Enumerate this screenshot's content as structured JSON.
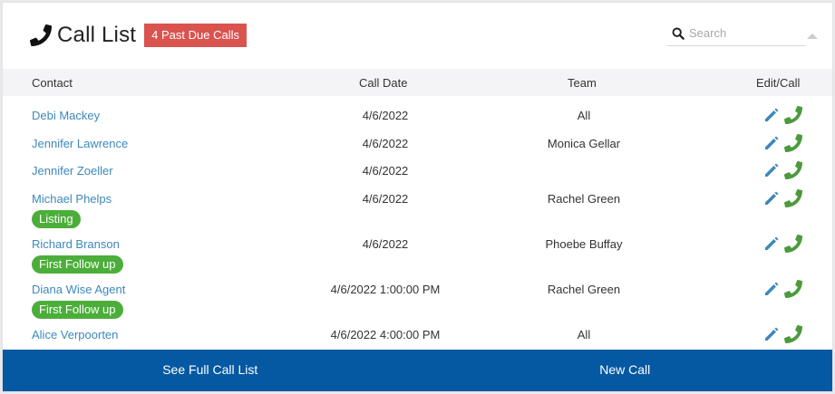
{
  "header": {
    "title": "Call List",
    "badge": "4 Past Due Calls",
    "search_placeholder": "Search"
  },
  "table": {
    "columns": [
      "Contact",
      "Call Date",
      "Team",
      "Edit/Call"
    ],
    "rows": [
      {
        "contact": "Debi Mackey",
        "call_date": "4/6/2022",
        "team": "All",
        "tag": ""
      },
      {
        "contact": "Jennifer Lawrence",
        "call_date": "4/6/2022",
        "team": "Monica Gellar",
        "tag": ""
      },
      {
        "contact": "Jennifer Zoeller",
        "call_date": "4/6/2022",
        "team": "",
        "tag": ""
      },
      {
        "contact": "Michael Phelps",
        "call_date": "4/6/2022",
        "team": "Rachel Green",
        "tag": "Listing"
      },
      {
        "contact": "Richard Branson",
        "call_date": "4/6/2022",
        "team": "Phoebe Buffay",
        "tag": "First Follow up"
      },
      {
        "contact": "Diana Wise Agent",
        "call_date": "4/6/2022 1:00:00 PM",
        "team": "Rachel Green",
        "tag": "First Follow up"
      },
      {
        "contact": "Alice Verpoorten",
        "call_date": "4/6/2022 4:00:00 PM",
        "team": "All",
        "tag": ""
      }
    ]
  },
  "footer": {
    "full_list_label": "See Full Call List",
    "new_call_label": "New Call"
  },
  "colors": {
    "badge": "#d9534f",
    "tag": "#4cae3a",
    "link": "#3d88b9",
    "footer": "#0559a2",
    "edit_icon": "#3d88b9",
    "call_icon": "#4c9a3c"
  },
  "icons": {
    "title": "phone-icon",
    "search": "search-icon",
    "edit": "pencil-icon",
    "call": "phone-icon"
  }
}
